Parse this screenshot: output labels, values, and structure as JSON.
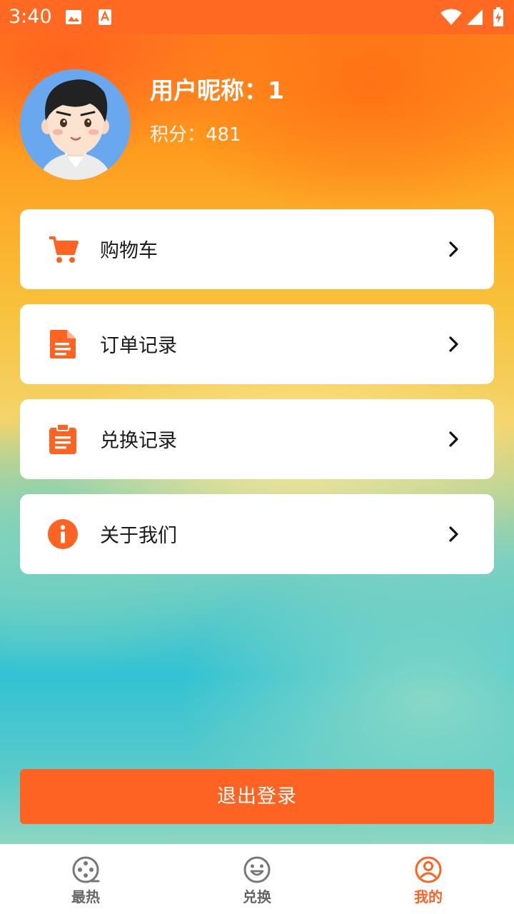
{
  "status_bar": {
    "time": "3:40",
    "icons": [
      "image-icon",
      "font-app-icon",
      "wifi-icon",
      "signal-icon",
      "battery-icon"
    ]
  },
  "profile": {
    "nickname": "用户昵称：1",
    "points": "积分：481"
  },
  "menu": [
    {
      "label": "购物车",
      "icon": "cart-icon"
    },
    {
      "label": "订单记录",
      "icon": "document-icon"
    },
    {
      "label": "兑换记录",
      "icon": "clipboard-icon"
    },
    {
      "label": "关于我们",
      "icon": "info-icon"
    }
  ],
  "logout_label": "退出登录",
  "tabs": [
    {
      "label": "最热",
      "icon": "film-reel-icon",
      "active": false
    },
    {
      "label": "兑换",
      "icon": "smiley-icon",
      "active": false
    },
    {
      "label": "我的",
      "icon": "user-circle-icon",
      "active": true
    }
  ],
  "colors": {
    "accent": "#ff6322",
    "status_bar": "#ff6922",
    "tab_inactive": "#666666"
  }
}
